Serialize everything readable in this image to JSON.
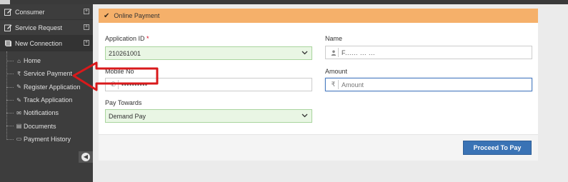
{
  "sidebar": {
    "items": [
      {
        "label": "Consumer",
        "icon": "edit-icon"
      },
      {
        "label": "Service Request",
        "icon": "edit-icon"
      },
      {
        "label": "New Connection",
        "icon": "book-icon"
      }
    ],
    "submenu": [
      {
        "label": "Home",
        "glyph": "⌂"
      },
      {
        "label": "Service Payment",
        "glyph": "₹"
      },
      {
        "label": "Register Application",
        "glyph": "✎"
      },
      {
        "label": "Track Application",
        "glyph": "✎"
      },
      {
        "label": "Notifications",
        "glyph": "✉"
      },
      {
        "label": "Documents",
        "glyph": "▤"
      },
      {
        "label": "Payment History",
        "glyph": "▭"
      }
    ]
  },
  "panel": {
    "title": "Online Payment",
    "header_color": "#f5b06a",
    "fields": {
      "application_id": {
        "label": "Application ID",
        "required_mark": "*",
        "value": "210261001"
      },
      "name": {
        "label": "Name",
        "value": "F...... ... ..."
      },
      "mobile": {
        "label": "Mobile No",
        "value": "••••••••••"
      },
      "amount": {
        "label": "Amount",
        "placeholder": "Amount",
        "addon": "₹"
      },
      "pay_towards": {
        "label": "Pay Towards",
        "value": "Demand Pay"
      }
    },
    "proceed_label": "Proceed To Pay"
  },
  "colors": {
    "accent": "#3a73b5",
    "sidebar_bg": "#3d3d3d",
    "valid_bg": "#e9f6e4",
    "annotation": "#d9191b"
  }
}
